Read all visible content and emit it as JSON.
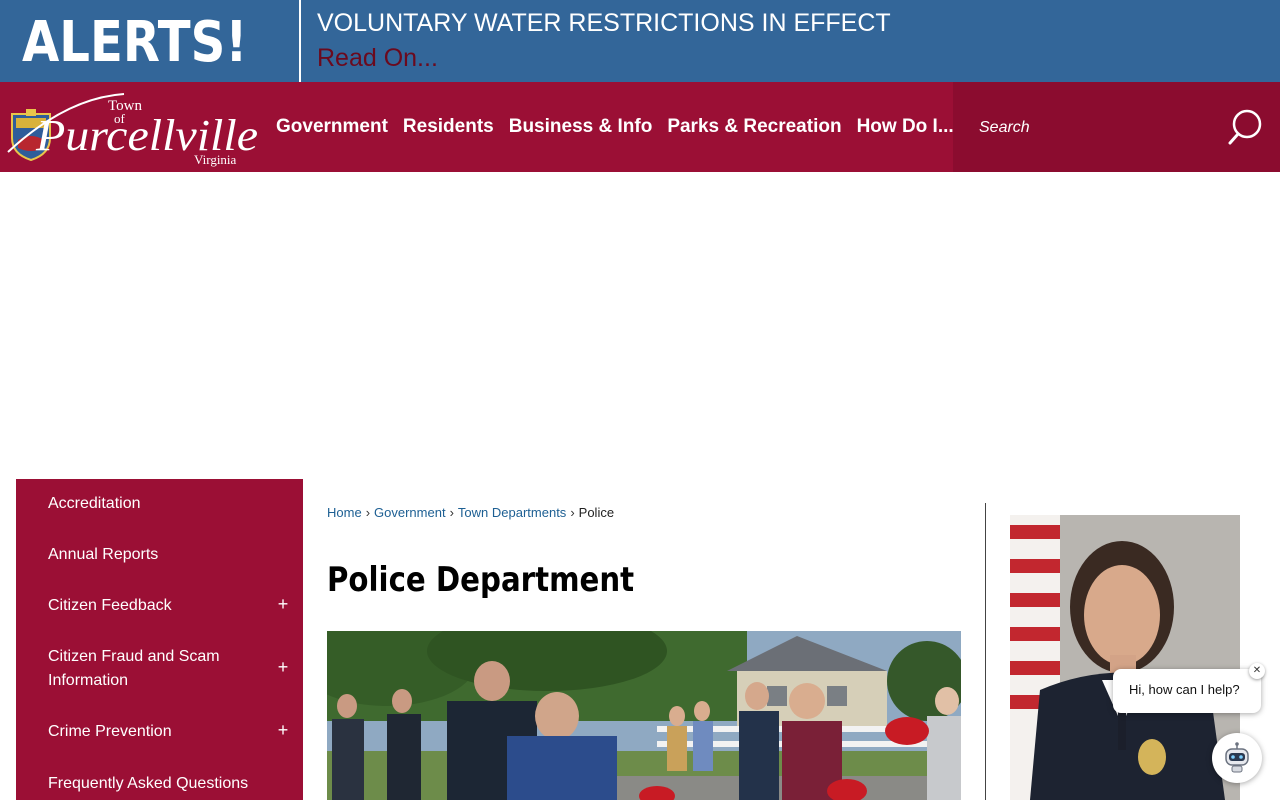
{
  "alert": {
    "label": "ALERTS!",
    "title": "VOLUNTARY WATER RESTRICTIONS IN EFFECT",
    "link_text": "Read On..."
  },
  "header": {
    "logo": {
      "line1": "Town",
      "line2": "of",
      "name": "Purcellville",
      "state": "Virginia"
    },
    "nav": [
      {
        "label": "Government"
      },
      {
        "label": "Residents"
      },
      {
        "label": "Business & Info"
      },
      {
        "label": "Parks & Recreation"
      },
      {
        "label": "How Do I..."
      }
    ],
    "search": {
      "placeholder": "Search",
      "icon": "search-icon"
    }
  },
  "sidenav": {
    "items": [
      {
        "label": "Accreditation",
        "expandable": false
      },
      {
        "label": "Annual Reports",
        "expandable": false
      },
      {
        "label": "Citizen Feedback",
        "expandable": true
      },
      {
        "label": "Citizen Fraud and Scam Information",
        "expandable": true
      },
      {
        "label": "Crime Prevention",
        "expandable": true
      },
      {
        "label": "Frequently Asked Questions",
        "expandable": false
      }
    ],
    "expand_symbol": "+"
  },
  "breadcrumb": {
    "items": [
      "Home",
      "Government",
      "Town Departments"
    ],
    "current": "Police",
    "separator": "›"
  },
  "main": {
    "title": "Police Department"
  },
  "chat": {
    "greeting": "Hi, how can I help?",
    "close_symbol": "✕"
  },
  "colors": {
    "alert_bg": "#336699",
    "brand_red": "#9b0f35",
    "search_bg": "#8b0c2f",
    "link_blue": "#1d5f93",
    "alert_link": "#6b0a1e"
  }
}
